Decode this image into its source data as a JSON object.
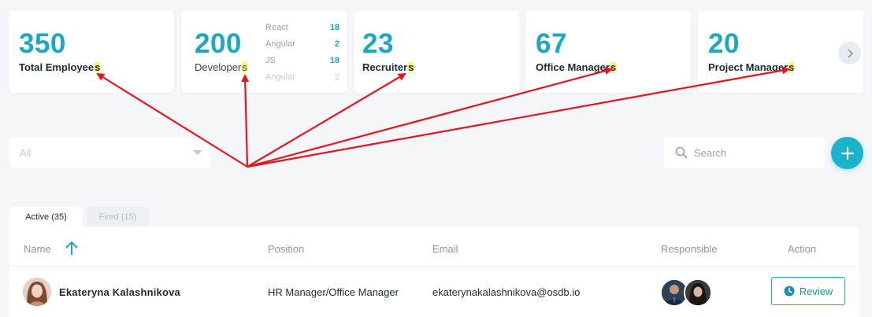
{
  "stats": [
    {
      "value": "350",
      "label_main": "Total Employee",
      "label_end": "s"
    },
    {
      "value": "200",
      "label_main": "Developer",
      "label_end": "s"
    },
    {
      "value": "23",
      "label_main": "Recruiter",
      "label_end": "s"
    },
    {
      "value": "67",
      "label_main": "Office Manager",
      "label_end": "s"
    },
    {
      "value": "20",
      "label_main": "Project Manager",
      "label_end": "s"
    }
  ],
  "developers_breakdown": [
    {
      "name": "React",
      "count": "18"
    },
    {
      "name": "Angular",
      "count": "2"
    },
    {
      "name": "JS",
      "count": "18"
    },
    {
      "name": "Angular",
      "count": "2"
    }
  ],
  "filter": {
    "value": "All"
  },
  "search": {
    "placeholder": "Search"
  },
  "tabs": [
    {
      "label": "Active (35)"
    },
    {
      "label": "Fired (15)"
    }
  ],
  "table": {
    "columns": [
      "Name",
      "Position",
      "Email",
      "Responsible",
      "Action"
    ],
    "rows": [
      {
        "name": "Ekateryna Kalashnikova",
        "position": "HR Manager/Office Manager",
        "email": "ekaterynakalashnikova@osdb.io",
        "action": "Review"
      }
    ]
  },
  "colors": {
    "accent": "#1aa8c2",
    "highlight": "#f7f57a",
    "annotation": "#e8131b"
  }
}
